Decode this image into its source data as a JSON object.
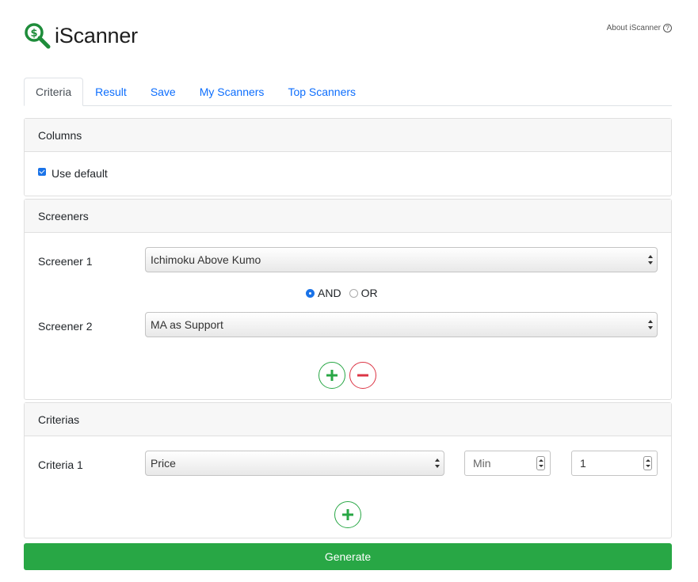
{
  "app": {
    "name": "iScanner",
    "about_label": "About iScanner"
  },
  "tabs": [
    {
      "label": "Criteria",
      "active": true
    },
    {
      "label": "Result",
      "active": false
    },
    {
      "label": "Save",
      "active": false
    },
    {
      "label": "My Scanners",
      "active": false
    },
    {
      "label": "Top Scanners",
      "active": false
    }
  ],
  "columns": {
    "title": "Columns",
    "use_default_label": "Use default",
    "use_default_checked": true
  },
  "screeners": {
    "title": "Screeners",
    "rows": [
      {
        "label": "Screener 1",
        "value": "Ichimoku Above Kumo"
      },
      {
        "label": "Screener 2",
        "value": "MA as Support"
      }
    ],
    "logic": {
      "and_label": "AND",
      "or_label": "OR",
      "selected": "AND"
    }
  },
  "criterias": {
    "title": "Criterias",
    "rows": [
      {
        "label": "Criteria 1",
        "field": "Price",
        "min_placeholder": "Min",
        "max_value": "1"
      }
    ]
  },
  "generate_label": "Generate",
  "colors": {
    "brand_green": "#28a745",
    "link_blue": "#0d6efd",
    "remove_red": "#dc3545",
    "accent_blue": "#1a73e8"
  },
  "icons": [
    "magnifier-dollar-icon",
    "help-circle-icon",
    "plus-icon",
    "minus-icon",
    "select-arrows-icon",
    "stepper-icon"
  ]
}
